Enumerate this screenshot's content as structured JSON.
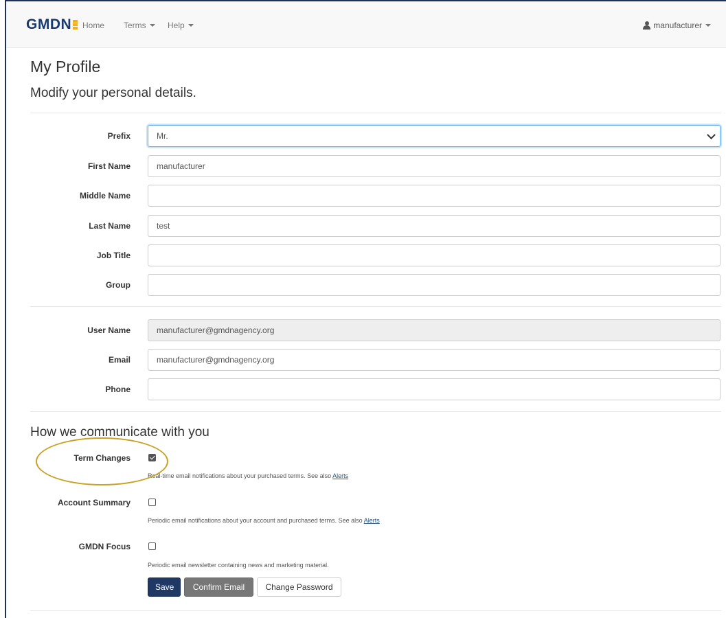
{
  "navbar": {
    "logo_text": "GMDN",
    "links": [
      {
        "label": "Home"
      },
      {
        "label": "Terms"
      },
      {
        "label": "Help"
      }
    ],
    "user_label": "manufacturer"
  },
  "page": {
    "title": "My Profile",
    "subtitle": "Modify your personal details."
  },
  "fields": {
    "prefix": {
      "label": "Prefix",
      "value": "Mr."
    },
    "first_name": {
      "label": "First Name",
      "value": "manufacturer"
    },
    "middle_name": {
      "label": "Middle Name",
      "value": ""
    },
    "last_name": {
      "label": "Last Name",
      "value": "test"
    },
    "job_title": {
      "label": "Job Title",
      "value": ""
    },
    "group": {
      "label": "Group",
      "value": ""
    },
    "user_name": {
      "label": "User Name",
      "value": "manufacturer@gmdnagency.org"
    },
    "email": {
      "label": "Email",
      "value": "manufacturer@gmdnagency.org"
    },
    "phone": {
      "label": "Phone",
      "value": ""
    }
  },
  "communication": {
    "title": "How we communicate with you",
    "term_changes": {
      "label": "Term Changes",
      "checked": true,
      "help": "Real-time email notifications about your purchased terms. See also ",
      "link": "Alerts"
    },
    "account_summary": {
      "label": "Account Summary",
      "checked": false,
      "help": "Periodic email notifications about your account and purchased terms. See also ",
      "link": "Alerts"
    },
    "gmdn_focus": {
      "label": "GMDN Focus",
      "checked": false,
      "help": "Periodic email newsletter containing news and marketing material."
    }
  },
  "buttons": {
    "save": "Save",
    "confirm_email": "Confirm Email",
    "change_password": "Change Password"
  },
  "colors": {
    "brand_navy": "#1a3a6e",
    "logo_accent": "#f2b01e",
    "primary_button": "#1f3864",
    "highlight_ellipse": "#c9a227"
  }
}
